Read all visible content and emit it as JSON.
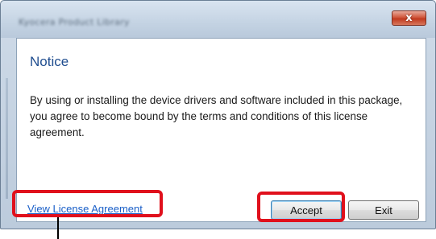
{
  "window": {
    "title": "Kyocera Product Library",
    "close_label": "x"
  },
  "notice": {
    "heading": "Notice",
    "body": "By using or installing the device drivers and software included in this package, you agree to become bound by the terms and conditions of this license agreement."
  },
  "actions": {
    "view_license_label": "View License Agreement",
    "accept_label": "Accept",
    "exit_label": "Exit"
  },
  "colors": {
    "highlight": "#e0101c",
    "heading": "#1f4d8f",
    "link": "#1a5fc8"
  }
}
